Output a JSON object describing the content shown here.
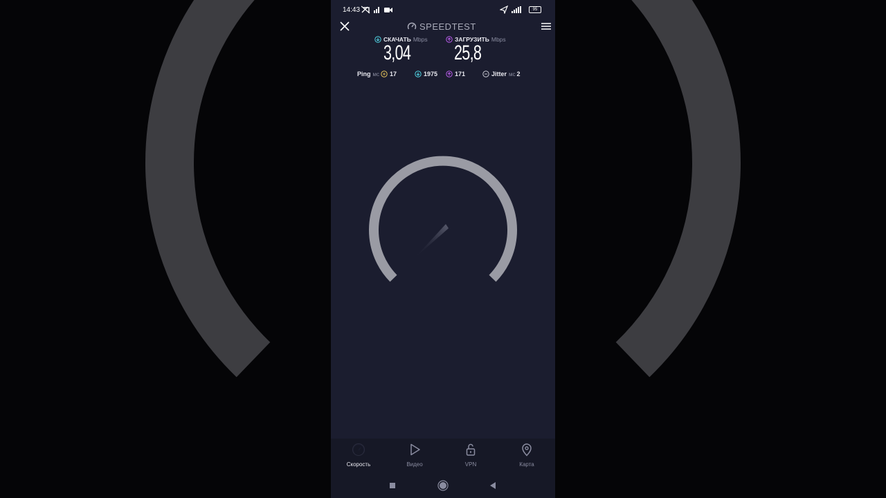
{
  "status_bar": {
    "time": "14:43",
    "battery": "95",
    "icons": [
      "no-signal-icon",
      "wifi-calling-icon",
      "video-camera-icon",
      "location-arrow-icon",
      "signal-bars-icon",
      "battery-icon"
    ]
  },
  "header": {
    "brand": "SPEEDTEST",
    "close_icon": "close-icon",
    "menu_icon": "hamburger-menu-icon"
  },
  "download": {
    "label": "СКАЧАТЬ",
    "unit": "Mbps",
    "value": "3,04",
    "color": "#4fd0e0"
  },
  "upload": {
    "label": "ЗАГРУЗИТЬ",
    "unit": "Mbps",
    "value": "25,8",
    "color": "#b65be8"
  },
  "ping": {
    "label": "Ping",
    "unit": "мс",
    "idle": "17",
    "download": "1975",
    "upload": "171",
    "idle_color": "#e6c35a"
  },
  "jitter": {
    "label": "Jitter",
    "unit": "мс",
    "value": "2"
  },
  "gauge": {
    "color": "#9a9ba4"
  },
  "tabs": [
    {
      "label": "Скорость",
      "icon": "speedometer-icon",
      "active": true
    },
    {
      "label": "Видео",
      "icon": "play-icon",
      "active": false
    },
    {
      "label": "VPN",
      "icon": "unlock-icon",
      "active": false
    },
    {
      "label": "Карта",
      "icon": "map-pin-icon",
      "active": false
    }
  ],
  "nav": {
    "icons": [
      "recents-square-icon",
      "home-circle-icon",
      "back-triangle-icon"
    ]
  }
}
